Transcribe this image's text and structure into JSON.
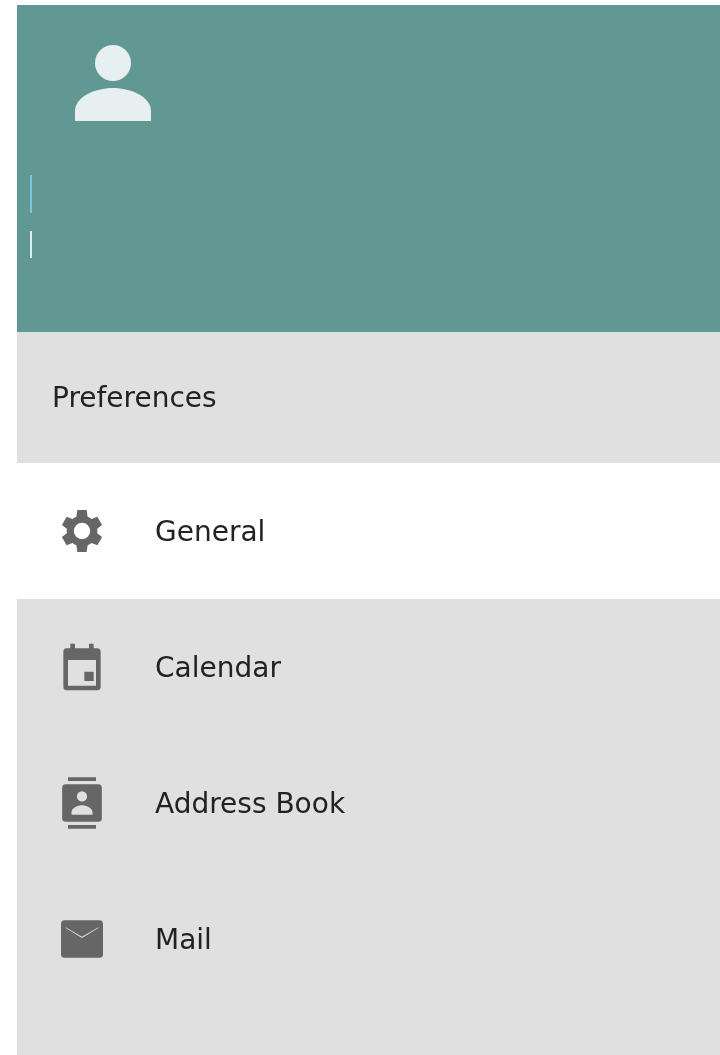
{
  "section_title": "Preferences",
  "items": [
    {
      "label": "General",
      "kind": "settings",
      "selected": true
    },
    {
      "label": "Calendar",
      "kind": "calendar",
      "selected": false
    },
    {
      "label": "Address Book",
      "kind": "contacts",
      "selected": false
    },
    {
      "label": "Mail",
      "kind": "mail",
      "selected": false
    }
  ]
}
